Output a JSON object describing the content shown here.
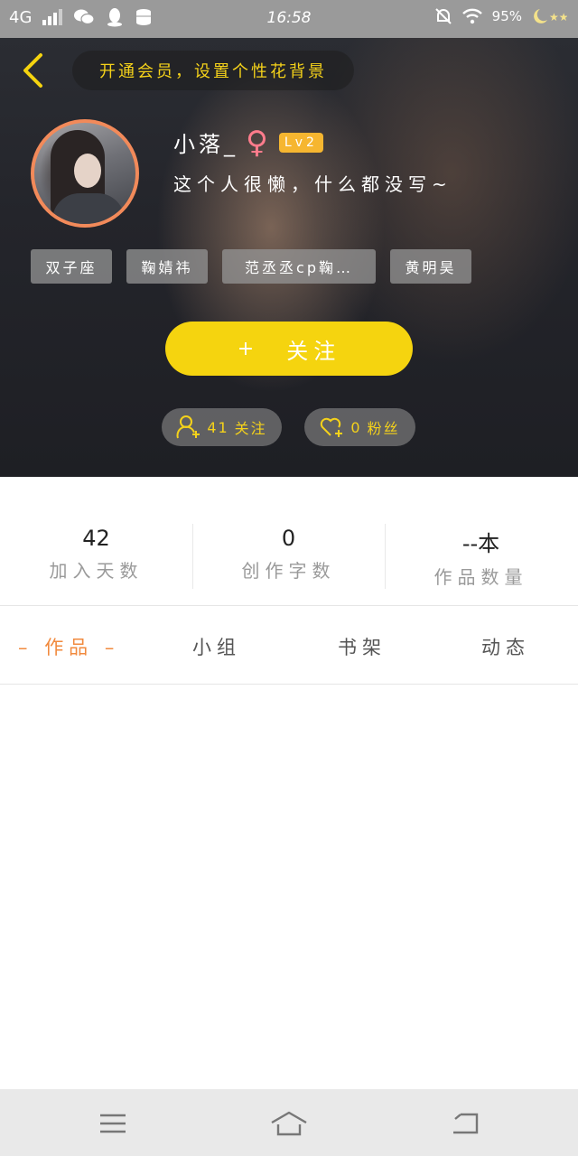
{
  "status_bar": {
    "network": "4G",
    "time": "16:58",
    "battery": "95%",
    "icons": [
      "wechat-icon",
      "qq-icon",
      "storage-icon",
      "mute-icon",
      "wifi-icon",
      "weather-moon-stars-icon"
    ]
  },
  "header": {
    "banner_text": "开通会员，设置个性花背景"
  },
  "profile": {
    "username": "小落_",
    "gender_symbol": "♀",
    "level": "Lv2",
    "bio": "这个人很懒，什么都没写~"
  },
  "tags": [
    "双子座",
    "鞠婧祎",
    "范丞丞cp鞠…",
    "黄明昊"
  ],
  "follow_button": {
    "plus": "+",
    "label": "关注"
  },
  "social": {
    "following_count": "41",
    "following_label": "关注",
    "fans_count": "0",
    "fans_label": "粉丝"
  },
  "stats": [
    {
      "value": "42",
      "label": "加入天数"
    },
    {
      "value": "0",
      "label": "创作字数"
    },
    {
      "value": "--本",
      "label": "作品数量"
    }
  ],
  "tabs": [
    {
      "label": "作品",
      "active": true
    },
    {
      "label": "小组",
      "active": false
    },
    {
      "label": "书架",
      "active": false
    },
    {
      "label": "动态",
      "active": false
    }
  ],
  "colors": {
    "accent_yellow": "#f5d40f",
    "active_tab": "#f18a3e",
    "avatar_border": "#f28a5a",
    "level_badge": "#f6b630",
    "gender": "#ff7c8c"
  }
}
